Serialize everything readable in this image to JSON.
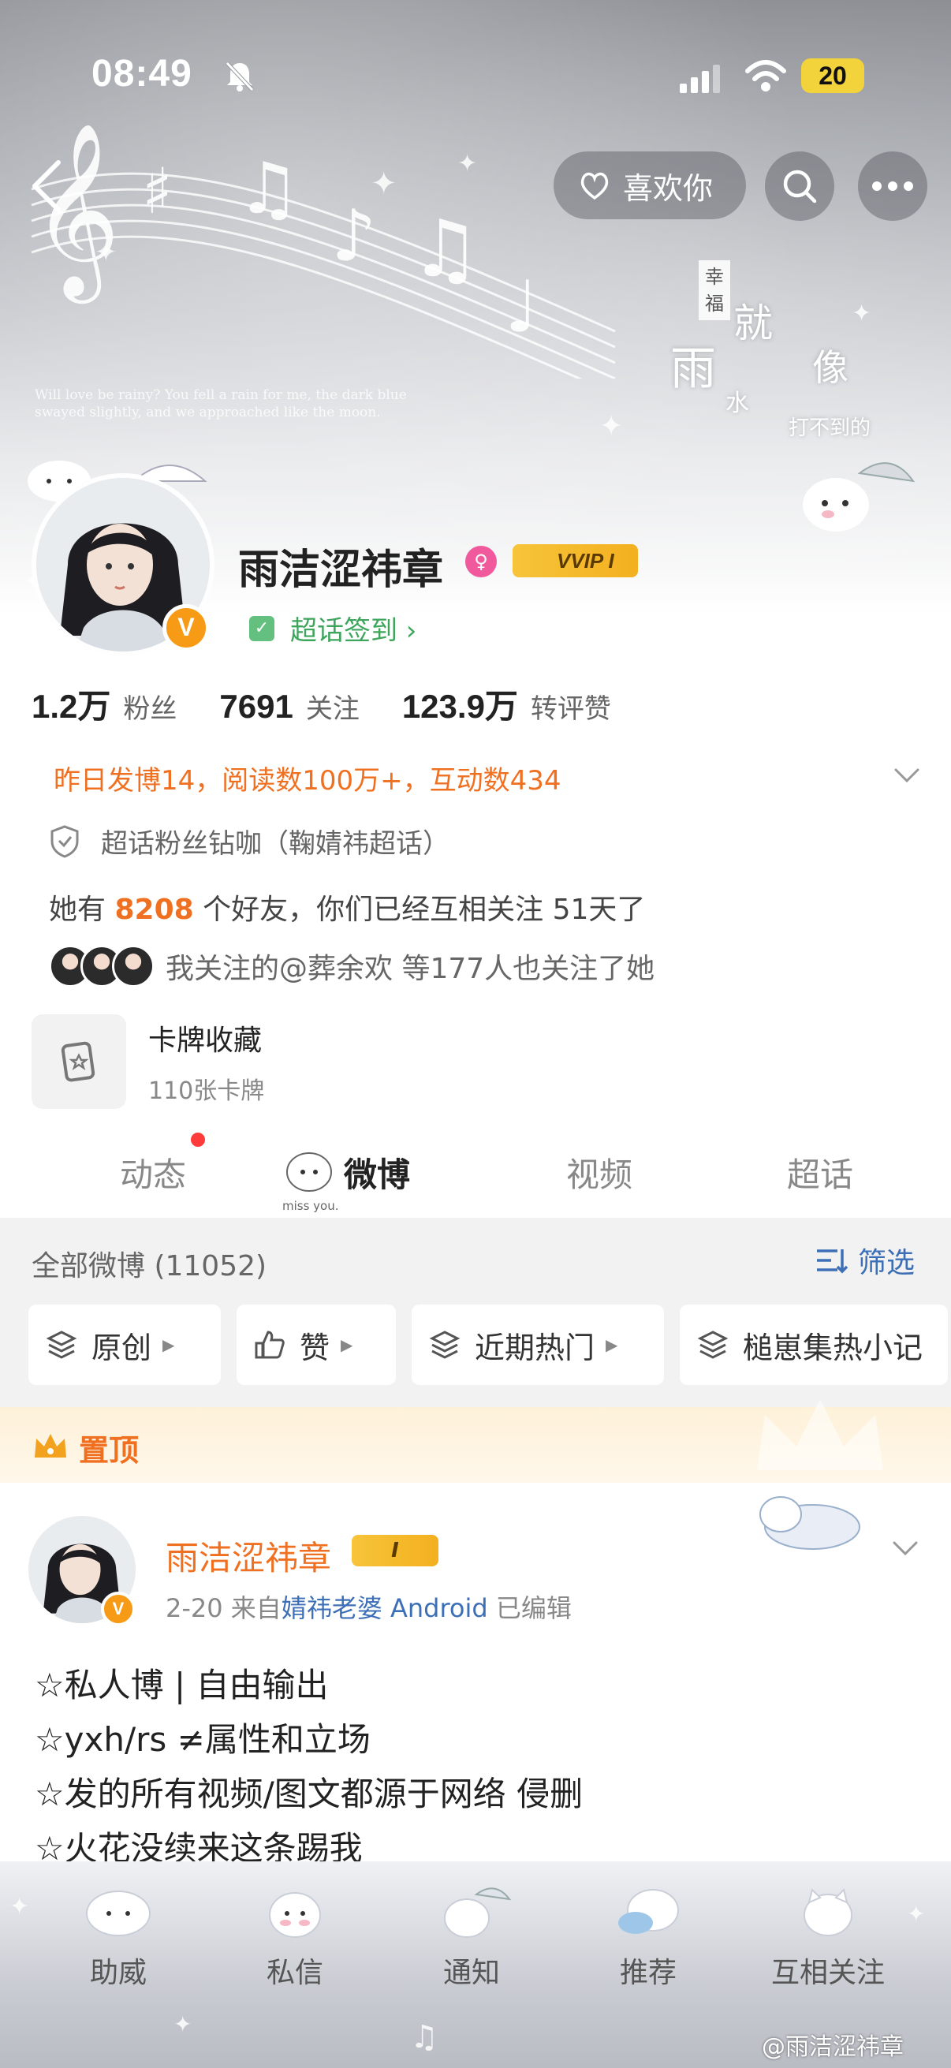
{
  "status_bar": {
    "time": "08:49",
    "battery": "20"
  },
  "nav": {
    "like_label": "喜欢你"
  },
  "banner": {
    "tagline": "Will love be rainy? You fell a rain for me, the dark blue swayed slightly, and we approached like the moon.",
    "vertical_text": "幸福",
    "text_rain": "雨",
    "text_jiu": "就",
    "text_xiang": "像",
    "text_water": "水",
    "text_line": "打不到的"
  },
  "profile": {
    "name": "雨洁涩祎章",
    "vvip_label": "VVIP I",
    "checkin_label": "超话签到 ›",
    "stats": [
      {
        "num": "1.2万",
        "label": "粉丝"
      },
      {
        "num": "7691",
        "label": "关注"
      },
      {
        "num": "123.9万",
        "label": "转评赞"
      }
    ],
    "activity": "昨日发博14，阅读数100万+，互动数434",
    "superfan": "超话粉丝钻咖（鞠婧祎超话）",
    "friends_prefix": "她有",
    "friends_count": "8208",
    "friends_suffix": "个好友，你们已经互相关注 51天了",
    "followed_by": "我关注的@葬余欢 等177人也关注了她",
    "cards_title": "卡牌收藏",
    "cards_sub": "110张卡牌"
  },
  "tabs": [
    {
      "label": "动态"
    },
    {
      "label": "微博"
    },
    {
      "label": "视频"
    },
    {
      "label": "超话"
    }
  ],
  "tab_deco": "miss you.",
  "feed": {
    "all_weibo": "全部微博 (11052)",
    "filter_label": "筛选",
    "chips": [
      {
        "label": "原创"
      },
      {
        "label": "赞"
      },
      {
        "label": "近期热门"
      },
      {
        "label": "槌崽集热小记"
      }
    ],
    "pinned_label": "置顶"
  },
  "post": {
    "name": "雨洁涩祎章",
    "badge": "I",
    "date": "2-20",
    "from": "来自",
    "source": "婧祎老婆 Android",
    "edited": "已编辑",
    "lines": [
      "☆私人博 | 自由输出",
      "☆yxh/rs ≠属性和立场",
      "☆发的所有视频/图文都源于网络 侵删",
      "☆火花没续来这条踢我"
    ]
  },
  "bottom_bar": [
    {
      "label": "助威"
    },
    {
      "label": "私信"
    },
    {
      "label": "通知"
    },
    {
      "label": "推荐"
    },
    {
      "label": "互相关注"
    }
  ],
  "watermark": "@雨洁涩祎章",
  "colors": {
    "accent_orange": "#f07022",
    "link_blue": "#3d6fb6",
    "vip_gold": "#f3b01f"
  }
}
